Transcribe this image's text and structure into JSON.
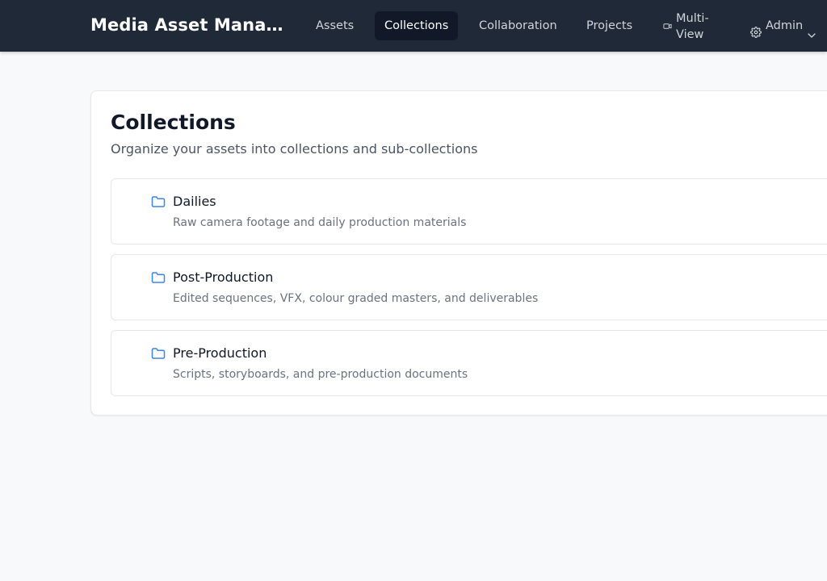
{
  "header": {
    "app_title": "Media Asset Mana…",
    "nav": {
      "assets": "Assets",
      "collections": "Collections",
      "collaboration": "Collaboration",
      "projects": "Projects",
      "multi_view": "Multi-View",
      "admin": "Admin"
    },
    "active_nav": "collections",
    "icons": {
      "multi_view": "video-camera-icon",
      "admin": "gear-icon",
      "admin_menu": "chevron-down-icon"
    }
  },
  "main": {
    "title": "Collections",
    "subtitle": "Organize your assets into collections and sub-collections",
    "collections": [
      {
        "icon": "folder-icon",
        "name": "Dailies",
        "description": "Raw camera footage and daily production materials"
      },
      {
        "icon": "folder-icon",
        "name": "Post-Production",
        "description": "Edited sequences, VFX, colour graded masters, and deliverables"
      },
      {
        "icon": "folder-icon",
        "name": "Pre-Production",
        "description": "Scripts, storyboards, and pre-production documents"
      }
    ]
  },
  "colors": {
    "header_bg": "#1f2937",
    "active_nav_bg": "#111827",
    "folder_icon": "#3b82f6",
    "page_bg": "#f8f9fb"
  }
}
